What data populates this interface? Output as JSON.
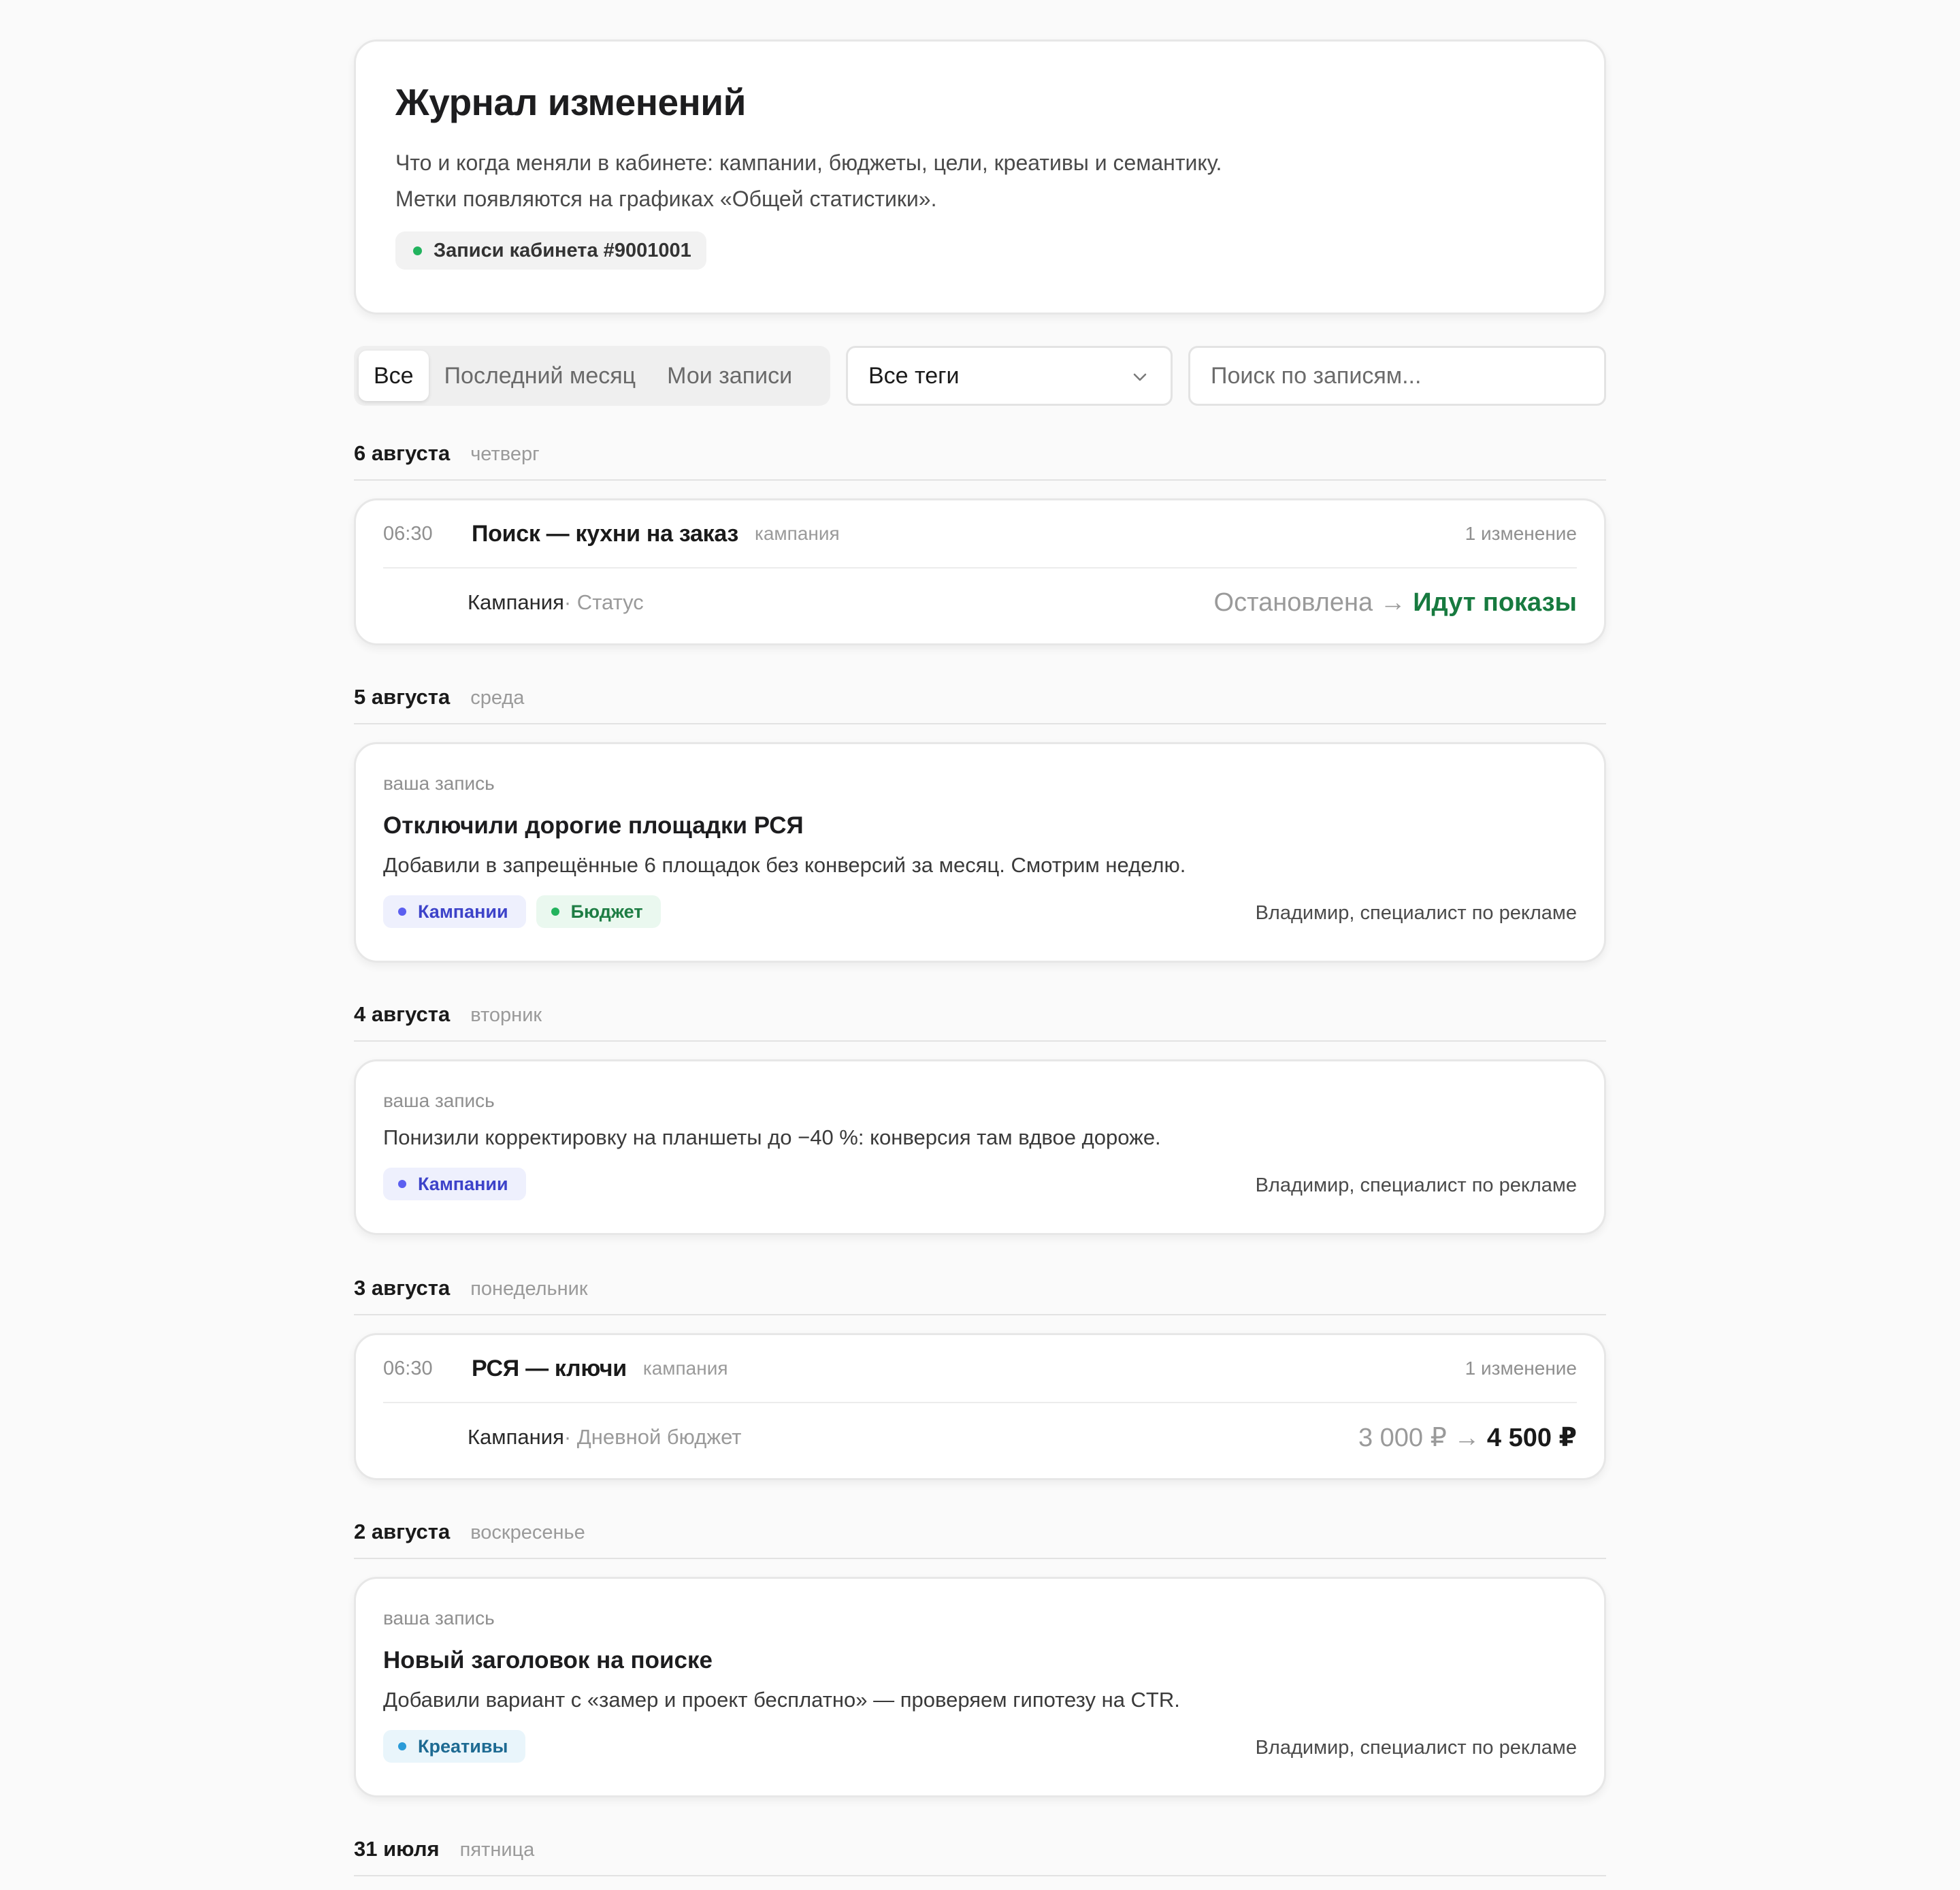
{
  "header": {
    "title": "Журнал изменений",
    "desc_line1": "Что и когда меняли в кабинете: кампании, бюджеты, цели, креативы и семантику.",
    "desc_line2": "Метки появляются на графиках «Общей статистики».",
    "account_chip": "Записи кабинета #9001001",
    "account_dot_color": "#22b35e"
  },
  "filters": {
    "tabs": [
      "Все",
      "Последний месяц",
      "Мои записи"
    ],
    "active_tab": "Все",
    "tags_select": "Все теги",
    "search_placeholder": "Поиск по записям..."
  },
  "days": [
    {
      "date": "6 августа",
      "weekday": "четверг",
      "change": {
        "time": "06:30",
        "name": "Поиск — кухни на заказ",
        "type": "кампания",
        "count": "1 изменение",
        "field": "Кампания",
        "sub": " · Статус",
        "old": "Остановлена",
        "arrow": " → ",
        "new": "Идут показы"
      }
    },
    {
      "date": "5 августа",
      "weekday": "среда",
      "note": {
        "label": "ваша запись",
        "title": "Отключили дорогие площадки РСЯ",
        "text": "Добавили в запрещённые 6 площадок без конверсий за месяц. Смотрим неделю.",
        "tags": [
          "Кампании",
          "Бюджет"
        ],
        "author": "Владимир, специалист по рекламе"
      }
    },
    {
      "date": "4 августа",
      "weekday": "вторник",
      "note": {
        "label": "ваша запись",
        "text": "Понизили корректировку на планшеты до −40 %: конверсия там вдвое дороже.",
        "tags": [
          "Кампании"
        ],
        "author": "Владимир, специалист по рекламе"
      }
    },
    {
      "date": "3 августа",
      "weekday": "понедельник",
      "change": {
        "time": "06:30",
        "name": "РСЯ — ключи",
        "type": "кампания",
        "count": "1 изменение",
        "field": "Кампания",
        "sub": " · Дневной бюджет",
        "old": "3 000 ₽",
        "arrow": " → ",
        "new": "4 500 ₽"
      }
    },
    {
      "date": "2 августа",
      "weekday": "воскресенье",
      "note": {
        "label": "ваша запись",
        "title": "Новый заголовок на поиске",
        "text": "Добавили вариант с «замер и проект бесплатно» — проверяем гипотезу на CTR.",
        "tags": [
          "Креативы"
        ],
        "author": "Владимир, специалист по рекламе"
      }
    },
    {
      "date": "31 июля",
      "weekday": "пятница"
    }
  ],
  "tag_colors": {
    "Кампании": {
      "bg": "#eef0fd",
      "fg": "#3d43c9",
      "dot": "#5b5ff0"
    },
    "Бюджет": {
      "bg": "#eaf8ef",
      "fg": "#1e7d44",
      "dot": "#23b35d"
    },
    "Креативы": {
      "bg": "#e9f5fb",
      "fg": "#1d6a92",
      "dot": "#2a9bd8"
    }
  }
}
